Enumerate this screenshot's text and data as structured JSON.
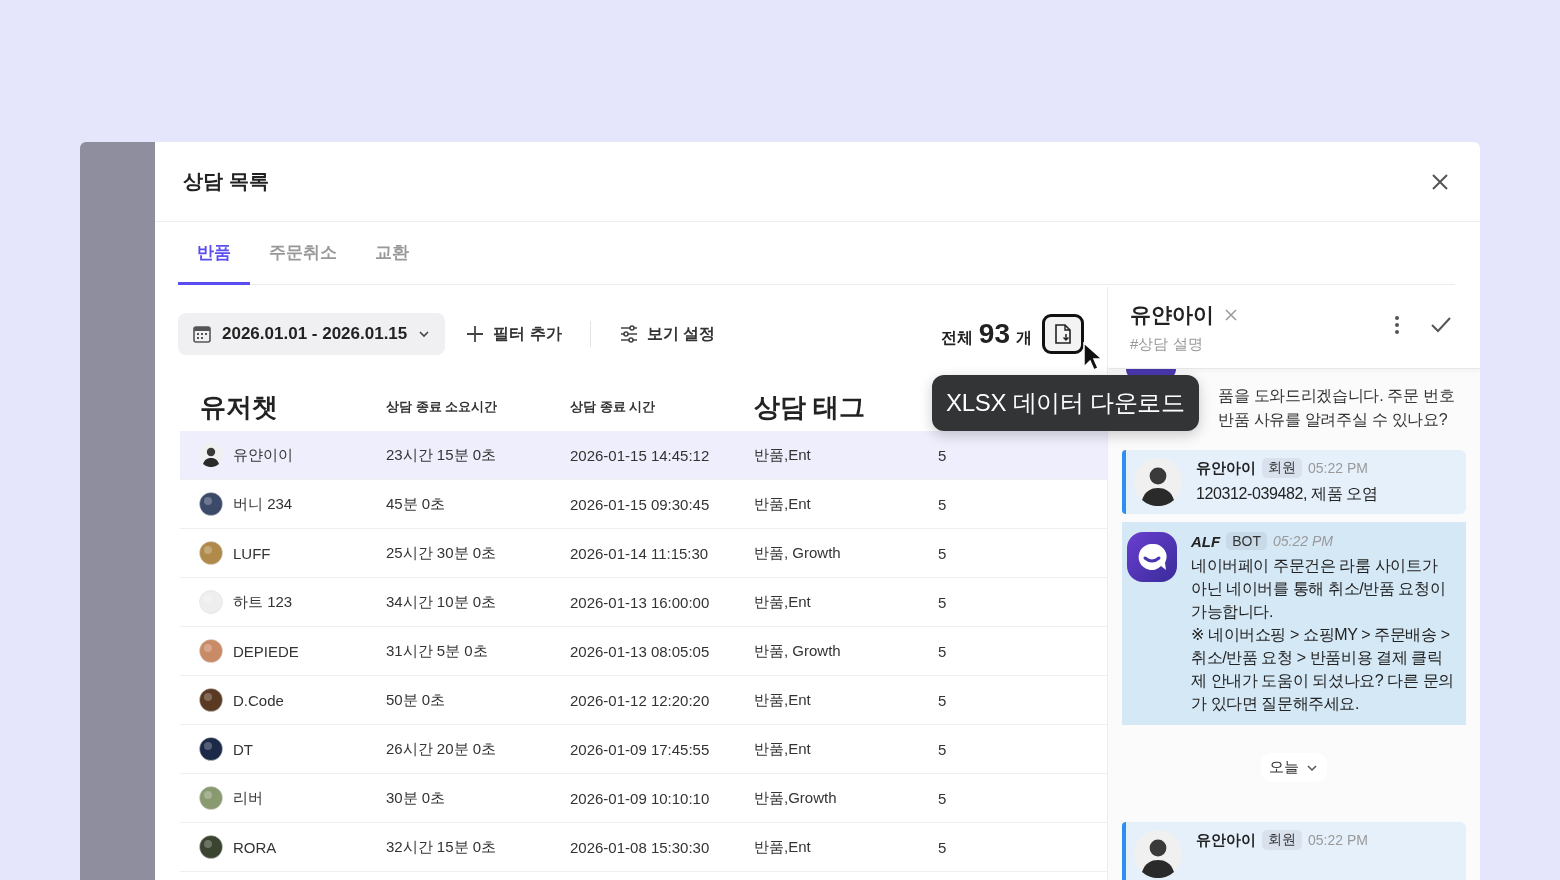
{
  "window": {
    "title": "상담 목록"
  },
  "tabs": [
    {
      "label": "반품",
      "selected": true
    },
    {
      "label": "주문취소",
      "selected": false
    },
    {
      "label": "교환",
      "selected": false
    }
  ],
  "toolbar": {
    "date_range": "2026.01.01 - 2026.01.15",
    "add_filter": "필터 추가",
    "view_settings": "보기 설정",
    "total_label": "전체",
    "total_count": "93",
    "total_unit": "개",
    "tooltip": "XLSX 데이터 다운로드"
  },
  "table": {
    "columns": [
      {
        "label": "유저챗",
        "emphasis": true
      },
      {
        "label": "상담 종료 소요시간",
        "emphasis": false
      },
      {
        "label": "상담 종료 시간",
        "emphasis": false
      },
      {
        "label": "상담 태그",
        "emphasis": true
      }
    ],
    "rows": [
      {
        "selected": true,
        "cells": [
          "유얀이이",
          "23시간 15분 0초",
          "2026-01-15 14:45:12",
          "반품,Ent",
          "5"
        ]
      },
      {
        "selected": false,
        "cells": [
          "버니 234",
          "45분 0초",
          "2026-01-15 09:30:45",
          "반품,Ent",
          "5"
        ]
      },
      {
        "selected": false,
        "cells": [
          "LUFF",
          "25시간 30분 0초",
          "2026-01-14 11:15:30",
          "반품, Growth",
          "5"
        ]
      },
      {
        "selected": false,
        "cells": [
          "하트 123",
          "34시간 10분 0초",
          "2026-01-13 16:00:00",
          "반품,Ent",
          "5"
        ]
      },
      {
        "selected": false,
        "cells": [
          "DEPIEDE",
          "31시간 5분 0초",
          "2026-01-13 08:05:05",
          "반품, Growth",
          "5"
        ]
      },
      {
        "selected": false,
        "cells": [
          "D.Code",
          "50분 0초",
          "2026-01-12 12:20:20",
          "반품,Ent",
          "5"
        ]
      },
      {
        "selected": false,
        "cells": [
          "DT",
          "26시간 20분 0초",
          "2026-01-09 17:45:55",
          "반품,Ent",
          "5"
        ]
      },
      {
        "selected": false,
        "cells": [
          "리버",
          "30분 0초",
          "2026-01-09 10:10:10",
          "반품,Growth",
          "5"
        ]
      },
      {
        "selected": false,
        "cells": [
          "RORA",
          "32시간 15분 0초",
          "2026-01-08 15:30:30",
          "반품,Ent",
          "5"
        ]
      }
    ]
  },
  "chat": {
    "name": "유얀아이",
    "description": "#상담 설명",
    "messages": [
      {
        "kind": "cut",
        "lines": [
          "품을 도와드리겠습니다. 주문 번호",
          "반품 사유를 알려주실 수 있나요?"
        ]
      },
      {
        "kind": "user",
        "author": "유안아이",
        "badge": "회원",
        "time": "05:22 PM",
        "text": "120312-039482, 제품 오염"
      },
      {
        "kind": "bot",
        "author": "ALF",
        "badge": "BOT",
        "time": "05:22 PM",
        "text": "네이버페이 주문건은 라룸 사이트가 아닌 네이버를 통해 취소/반품 요청이 가능합니다.\n※ 네이버쇼핑 > 쇼핑MY > 주문배송 > 취소/반품 요청 > 반품비용 결제 클릭\n제 안내가 도움이 되셨나요? 다른 문의가 있다면 질문해주세요."
      },
      {
        "kind": "divider",
        "text": "오늘"
      },
      {
        "kind": "user",
        "author": "유안아이",
        "badge": "회원",
        "time": "05:22 PM"
      }
    ]
  }
}
